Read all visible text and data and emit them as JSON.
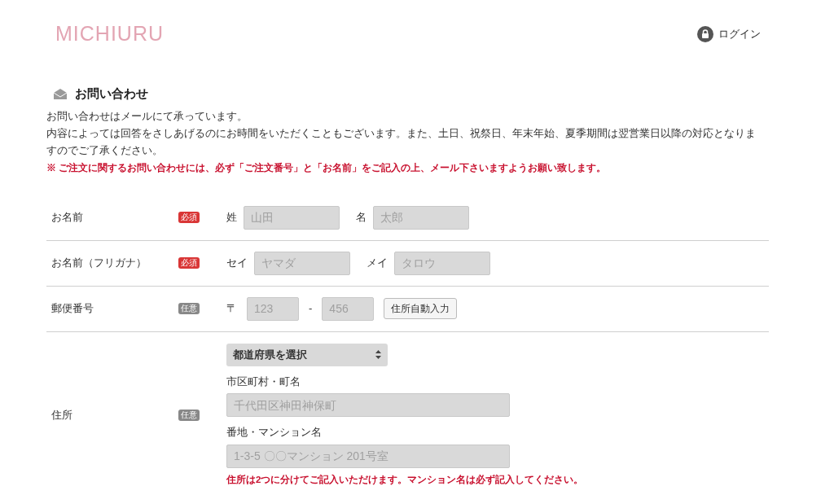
{
  "header": {
    "logo": "MICHIURU",
    "login": "ログイン"
  },
  "section": {
    "title": "お問い合わせ",
    "paragraphs": [
      "お問い合わせはメールにて承っています。",
      "内容によっては回答をさしあげるのにお時間をいただくこともございます。また、土日、祝祭日、年末年始、夏季期間は翌営業日以降の対応となりますのでご了承ください。"
    ],
    "notice": "※ ご注文に関するお問い合わせには、必ず「ご注文番号」と「お名前」をご記入の上、メール下さいますようお願い致します。"
  },
  "rows": [
    {
      "kind": "pair",
      "label": "お名前",
      "badge": "必須",
      "required": true,
      "fields": [
        {
          "label": "姓",
          "placeholder": "山田"
        },
        {
          "label": "名",
          "placeholder": "太郎"
        }
      ]
    },
    {
      "kind": "pair",
      "label": "お名前（フリガナ）",
      "badge": "必須",
      "required": true,
      "fields": [
        {
          "label": "セイ",
          "placeholder": "ヤマダ"
        },
        {
          "label": "メイ",
          "placeholder": "タロウ"
        }
      ]
    },
    {
      "kind": "postal",
      "label": "郵便番号",
      "badge": "任意",
      "required": false,
      "prefix": "〒",
      "separator": "-",
      "fields": [
        {
          "placeholder": "123"
        },
        {
          "placeholder": "456"
        }
      ],
      "button": "住所自動入力"
    },
    {
      "kind": "address",
      "label": "住所",
      "badge": "任意",
      "required": false,
      "select": "都道府県を選択",
      "fields": [
        {
          "label": "市区町村・町名",
          "placeholder": "千代田区神田神保町"
        },
        {
          "label": "番地・マンション名",
          "placeholder": "1-3-5 〇〇マンション 201号室"
        }
      ],
      "note": "住所は2つに分けてご記入いただけます。マンション名は必ず記入してください。"
    }
  ]
}
